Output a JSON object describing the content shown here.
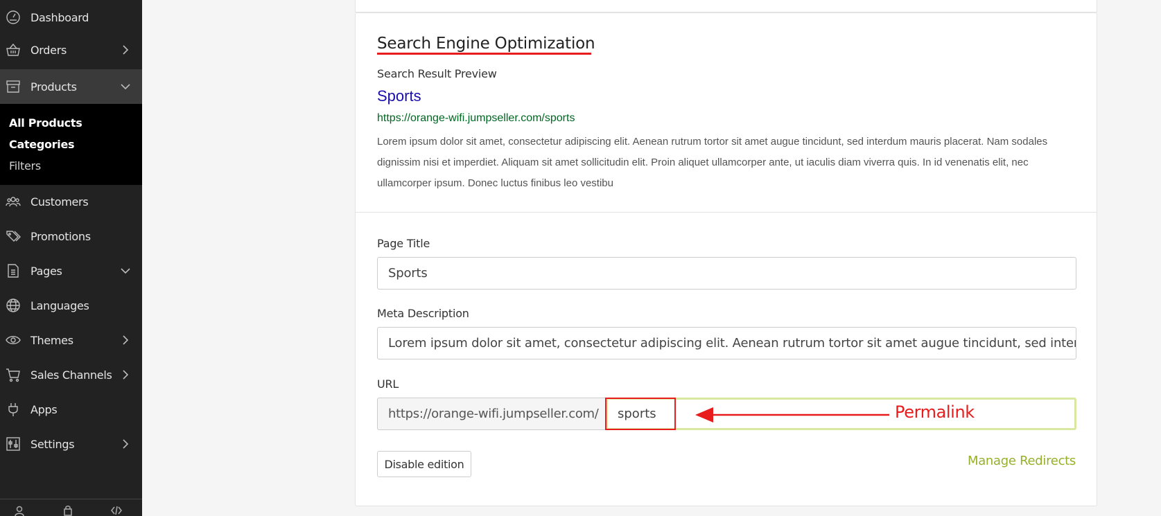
{
  "sidebar": {
    "items": [
      {
        "label": "Dashboard",
        "icon": "dashboard-icon"
      },
      {
        "label": "Orders",
        "icon": "basket-icon",
        "chevron": "right"
      },
      {
        "label": "Products",
        "icon": "box-icon",
        "chevron": "down",
        "active": true
      },
      {
        "label": "Customers",
        "icon": "users-icon"
      },
      {
        "label": "Promotions",
        "icon": "tags-icon"
      },
      {
        "label": "Pages",
        "icon": "page-icon",
        "chevron": "down"
      },
      {
        "label": "Languages",
        "icon": "globe-icon"
      },
      {
        "label": "Themes",
        "icon": "eye-icon",
        "chevron": "right"
      },
      {
        "label": "Sales Channels",
        "icon": "cart-icon",
        "chevron": "right"
      },
      {
        "label": "Apps",
        "icon": "plug-icon"
      },
      {
        "label": "Settings",
        "icon": "sliders-icon",
        "chevron": "right"
      }
    ],
    "submenu": [
      "All Products",
      "Categories",
      "Filters"
    ]
  },
  "seo": {
    "title": "Search Engine Optimization",
    "preview_label": "Search Result Preview",
    "preview_title": "Sports",
    "preview_url": "https://orange-wifi.jumpseller.com/sports",
    "preview_description": "Lorem ipsum dolor sit amet, consectetur adipiscing elit. Aenean rutrum tortor sit amet augue tincidunt, sed interdum mauris placerat. Nam sodales dignissim nisi et imperdiet. Aliquam sit amet sollicitudin elit. Proin aliquet ullamcorper ante, ut iaculis diam viverra quis. In id venenatis elit, nec ullamcorper ipsum. Donec luctus finibus leo vestibu"
  },
  "form": {
    "page_title_label": "Page Title",
    "page_title_value": "Sports",
    "meta_label": "Meta Description",
    "meta_value": "Lorem ipsum dolor sit amet, consectetur adipiscing elit. Aenean rutrum tortor sit amet augue tincidunt, sed interdum mauris placerat.",
    "url_label": "URL",
    "url_prefix": "https://orange-wifi.jumpseller.com/",
    "url_value": "sports",
    "annotation": "Permalink",
    "disable_button": "Disable edition",
    "manage_redirects": "Manage Redirects"
  },
  "colors": {
    "accent_green": "#95b02a",
    "annotation_red": "#e81c1c",
    "link_blue": "#1a0dab",
    "url_green": "#006621"
  }
}
